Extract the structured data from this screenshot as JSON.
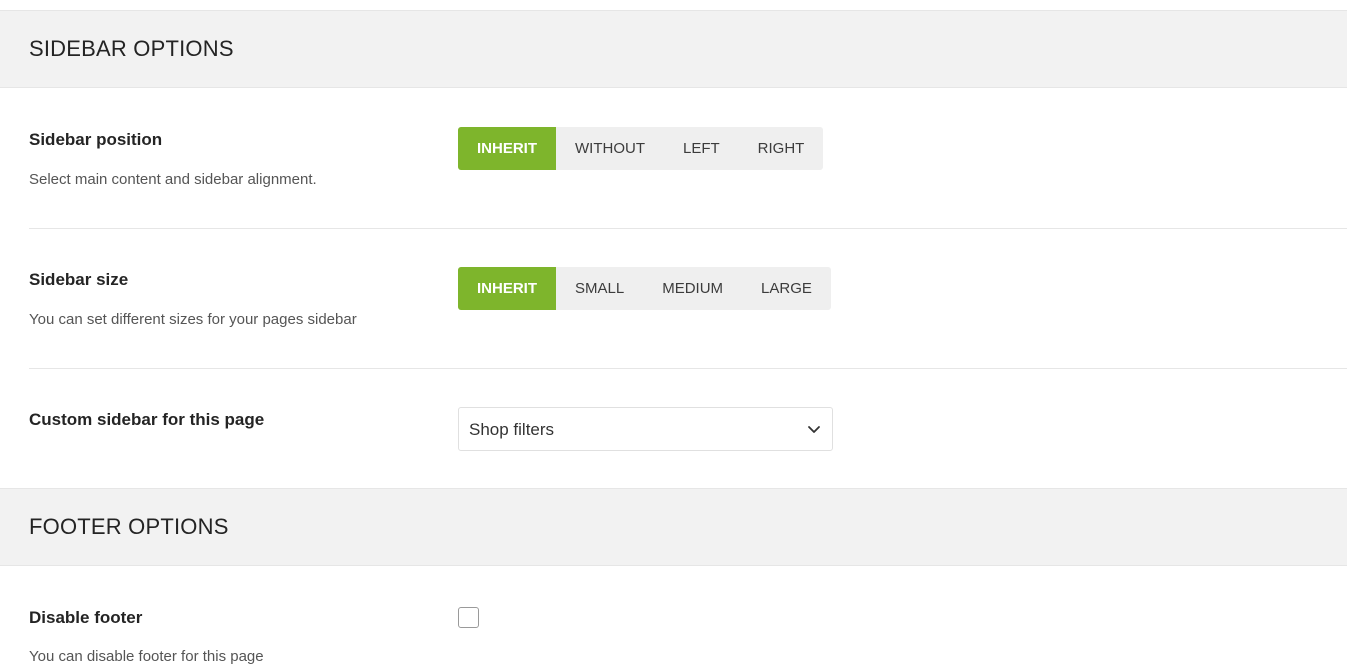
{
  "sidebar_section": {
    "title": "SIDEBAR OPTIONS"
  },
  "sidebar_position": {
    "title": "Sidebar position",
    "description": "Select main content and sidebar alignment.",
    "options": [
      "INHERIT",
      "WITHOUT",
      "LEFT",
      "RIGHT"
    ],
    "selected": "INHERIT"
  },
  "sidebar_size": {
    "title": "Sidebar size",
    "description": "You can set different sizes for your pages sidebar",
    "options": [
      "INHERIT",
      "SMALL",
      "MEDIUM",
      "LARGE"
    ],
    "selected": "INHERIT"
  },
  "custom_sidebar": {
    "title": "Custom sidebar for this page",
    "selected_value": "Shop filters"
  },
  "footer_section": {
    "title": "FOOTER OPTIONS"
  },
  "disable_footer": {
    "title": "Disable footer",
    "description": "You can disable footer for this page",
    "checked": false
  },
  "colors": {
    "accent": "#7eb52c",
    "section_bg": "#f2f2f2",
    "button_bg": "#efefef"
  }
}
